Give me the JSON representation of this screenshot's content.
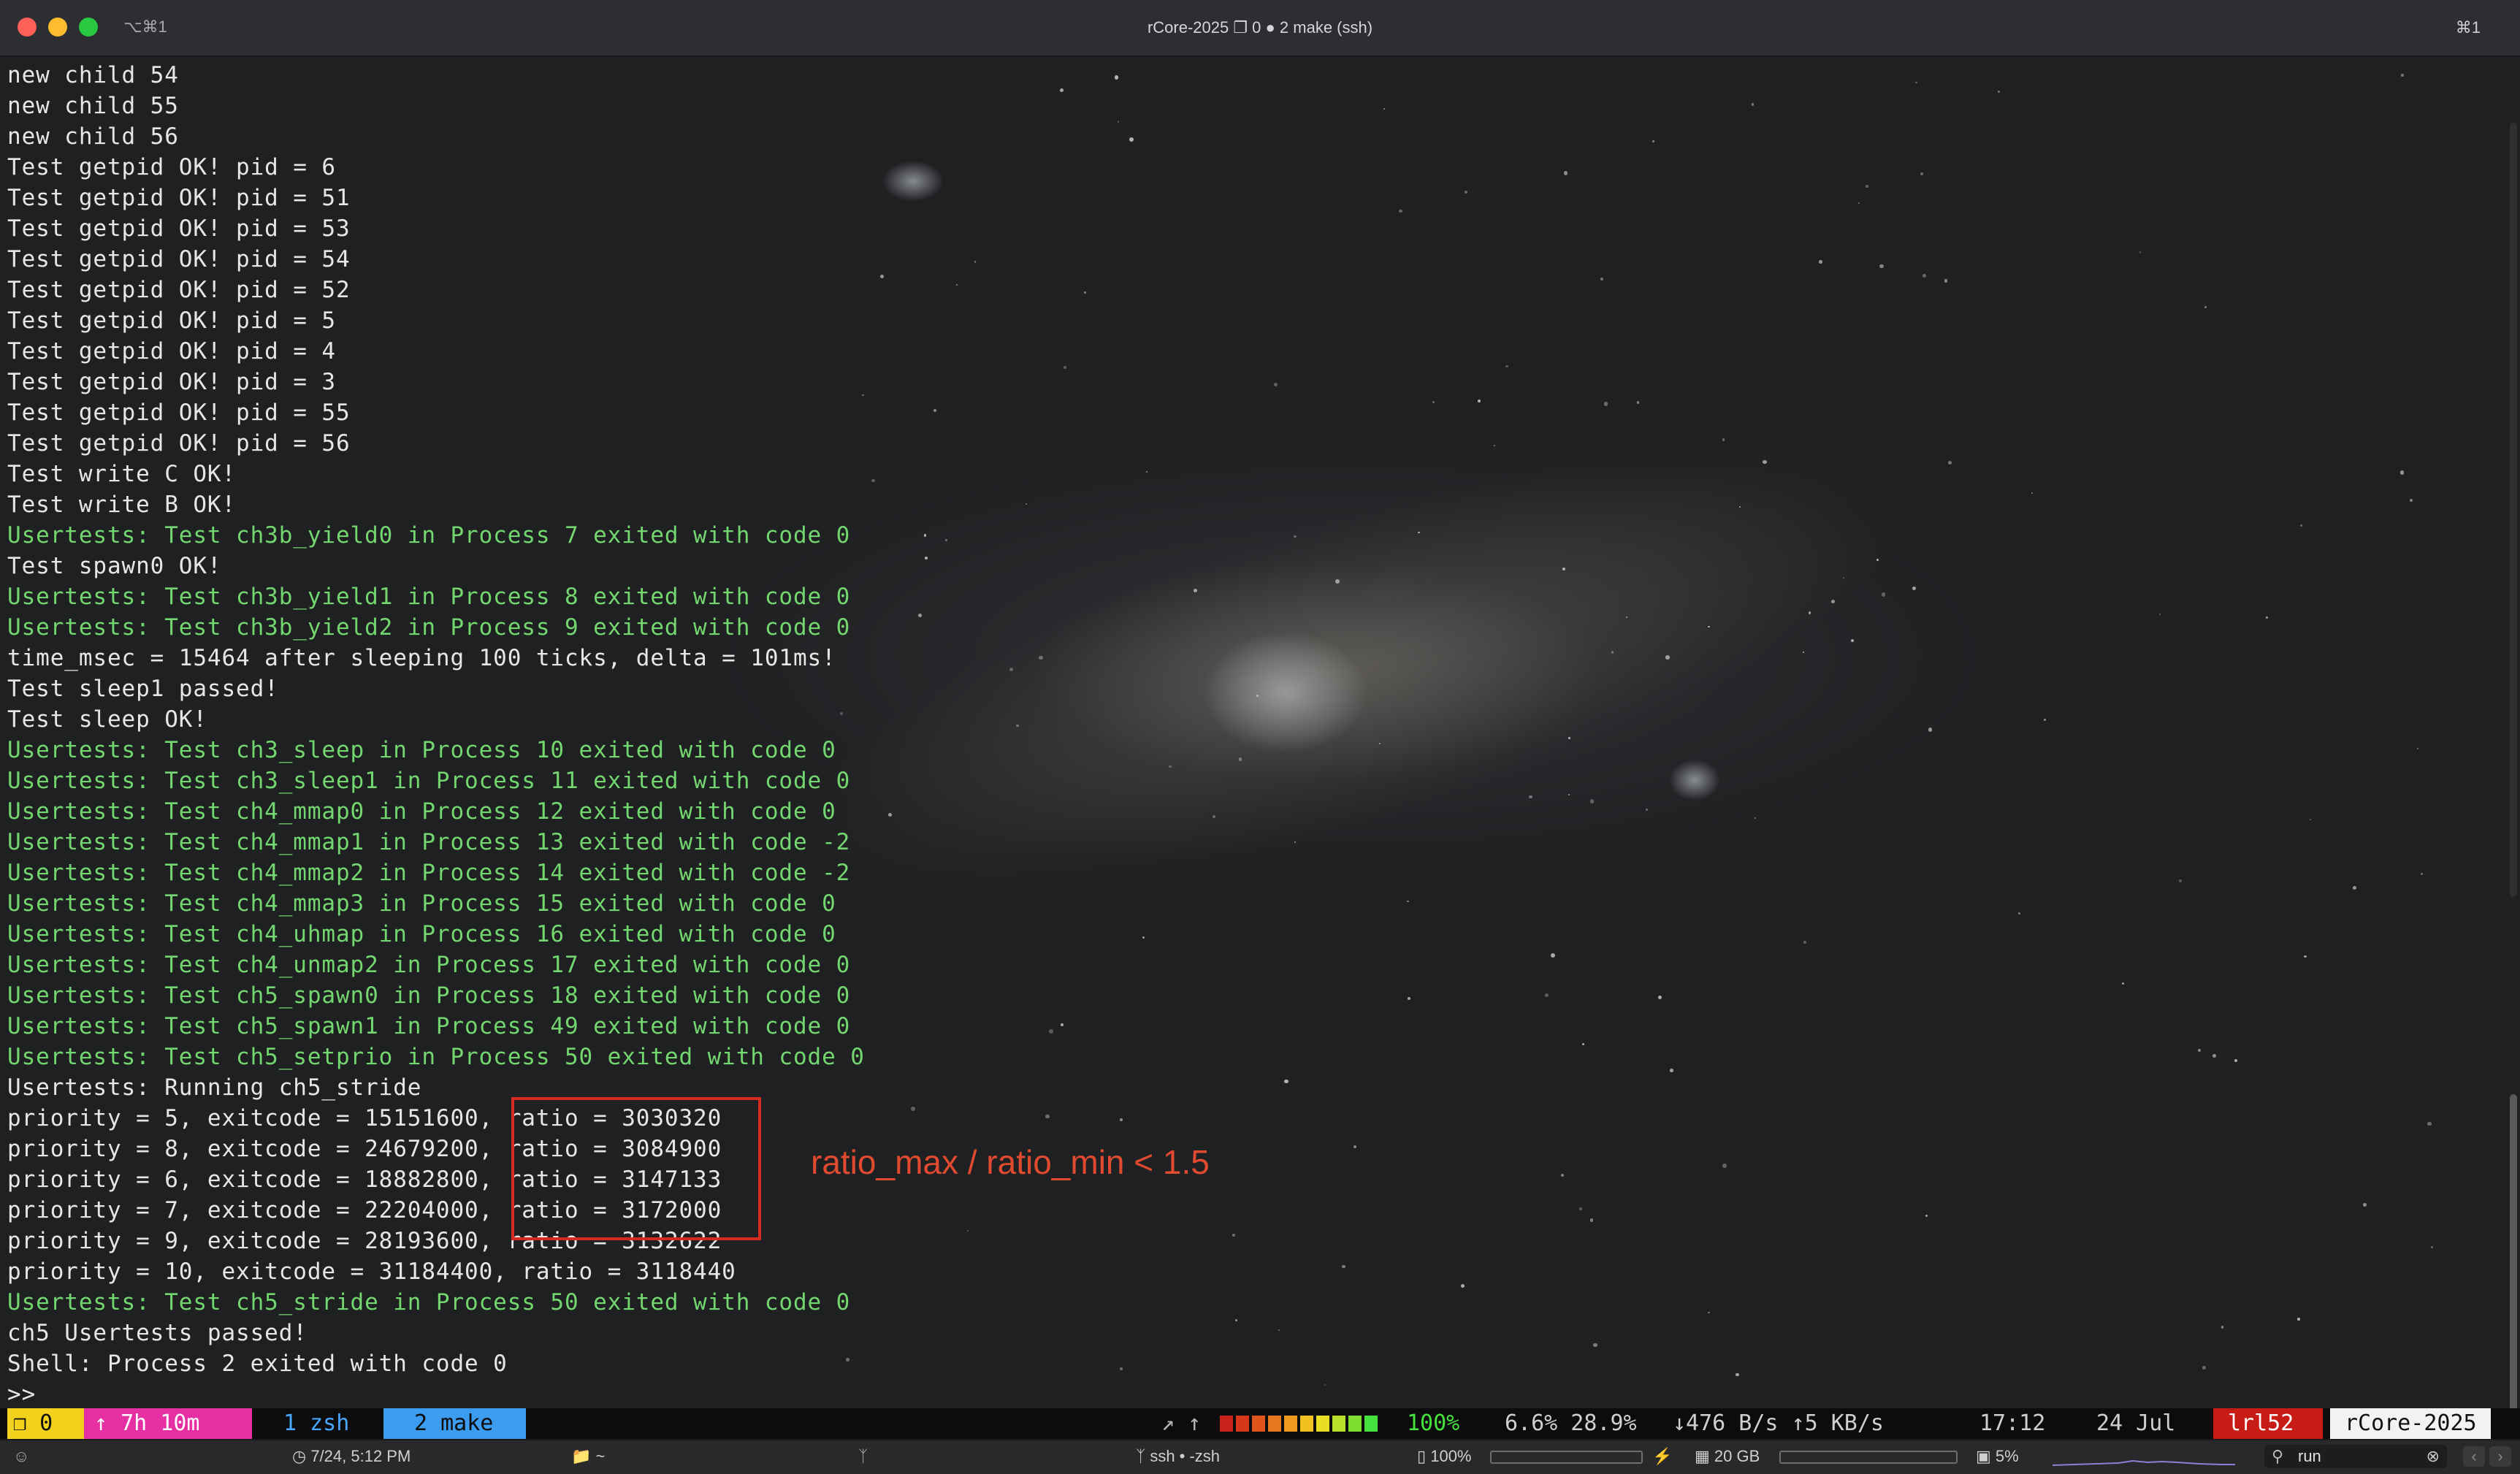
{
  "window": {
    "title": "rCore-2025 ❐ 0 ● 2 make (ssh)",
    "left_shortcut": "⌥⌘1",
    "right_shortcut": "⌘1"
  },
  "terminal": {
    "lines": [
      {
        "text": "new child 54",
        "style": "plain"
      },
      {
        "text": "new child 55",
        "style": "plain"
      },
      {
        "text": "new child 56",
        "style": "plain"
      },
      {
        "text": "Test getpid OK! pid = 6",
        "style": "plain"
      },
      {
        "text": "Test getpid OK! pid = 51",
        "style": "plain"
      },
      {
        "text": "Test getpid OK! pid = 53",
        "style": "plain"
      },
      {
        "text": "Test getpid OK! pid = 54",
        "style": "plain"
      },
      {
        "text": "Test getpid OK! pid = 52",
        "style": "plain"
      },
      {
        "text": "Test getpid OK! pid = 5",
        "style": "plain"
      },
      {
        "text": "Test getpid OK! pid = 4",
        "style": "plain"
      },
      {
        "text": "Test getpid OK! pid = 3",
        "style": "plain"
      },
      {
        "text": "Test getpid OK! pid = 55",
        "style": "plain"
      },
      {
        "text": "Test getpid OK! pid = 56",
        "style": "plain"
      },
      {
        "text": "Test write C OK!",
        "style": "plain"
      },
      {
        "text": "Test write B OK!",
        "style": "plain"
      },
      {
        "text": "Usertests: Test ch3b_yield0 in Process 7 exited with code 0",
        "style": "green"
      },
      {
        "text": "Test spawn0 OK!",
        "style": "plain"
      },
      {
        "text": "Usertests: Test ch3b_yield1 in Process 8 exited with code 0",
        "style": "green"
      },
      {
        "text": "Usertests: Test ch3b_yield2 in Process 9 exited with code 0",
        "style": "green"
      },
      {
        "text": "time_msec = 15464 after sleeping 100 ticks, delta = 101ms!",
        "style": "plain"
      },
      {
        "text": "Test sleep1 passed!",
        "style": "plain"
      },
      {
        "text": "Test sleep OK!",
        "style": "plain"
      },
      {
        "text": "Usertests: Test ch3_sleep in Process 10 exited with code 0",
        "style": "green"
      },
      {
        "text": "Usertests: Test ch3_sleep1 in Process 11 exited with code 0",
        "style": "green"
      },
      {
        "text": "Usertests: Test ch4_mmap0 in Process 12 exited with code 0",
        "style": "green"
      },
      {
        "text": "Usertests: Test ch4_mmap1 in Process 13 exited with code -2",
        "style": "green"
      },
      {
        "text": "Usertests: Test ch4_mmap2 in Process 14 exited with code -2",
        "style": "green"
      },
      {
        "text": "Usertests: Test ch4_mmap3 in Process 15 exited with code 0",
        "style": "green"
      },
      {
        "text": "Usertests: Test ch4_uhmap in Process 16 exited with code 0",
        "style": "green"
      },
      {
        "text": "Usertests: Test ch4_unmap2 in Process 17 exited with code 0",
        "style": "green"
      },
      {
        "text": "Usertests: Test ch5_spawn0 in Process 18 exited with code 0",
        "style": "green"
      },
      {
        "text": "Usertests: Test ch5_spawn1 in Process 49 exited with code 0",
        "style": "green"
      },
      {
        "text": "Usertests: Test ch5_setprio in Process 50 exited with code 0",
        "style": "green"
      },
      {
        "text": "Usertests: Running ch5_stride",
        "style": "plain"
      },
      {
        "text": "priority = 5, exitcode = 15151600, ratio = 3030320",
        "style": "plain"
      },
      {
        "text": "priority = 8, exitcode = 24679200, ratio = 3084900",
        "style": "plain"
      },
      {
        "text": "priority = 6, exitcode = 18882800, ratio = 3147133",
        "style": "plain"
      },
      {
        "text": "priority = 7, exitcode = 22204000, ratio = 3172000",
        "style": "plain"
      },
      {
        "text": "priority = 9, exitcode = 28193600, ratio = 3132622",
        "style": "plain"
      },
      {
        "text": "priority = 10, exitcode = 31184400, ratio = 3118440",
        "style": "plain"
      },
      {
        "text": "Usertests: Test ch5_stride in Process 50 exited with code 0",
        "style": "green"
      },
      {
        "text": "ch5 Usertests passed!",
        "style": "plain"
      },
      {
        "text": "Shell: Process 2 exited with code 0",
        "style": "plain"
      },
      {
        "text": ">>",
        "style": "prompt"
      }
    ],
    "annotation": "ratio_max / ratio_min < 1.5",
    "annotation_color": "#e04a2f",
    "box_color": "#d52a23"
  },
  "tmux": {
    "session": "❐ 0",
    "uptime": "↑ 7h 10m",
    "window1": "1 zsh",
    "window2": "2 make",
    "arrows": "↗ ↑",
    "battery": "100%",
    "load": "6.6% 28.9%",
    "net": "↓476 B/s ↑5 KB/s",
    "time": "17:12",
    "date": "24 Jul",
    "user": "lrl52",
    "host": "rCore-2025",
    "colors": {
      "session": "#f2d21c",
      "uptime": "#e52fa3",
      "window2": "#3b9cf0",
      "user": "#c71b15",
      "battery": "#46e23e"
    }
  },
  "statusbar": {
    "user_icon": "person-icon",
    "clock": "7/24, 5:12 PM",
    "folder": "~",
    "branch_icon": "git-branch-icon",
    "session": "ssh • -zsh",
    "battery": "100%",
    "battery_level": 1.0,
    "memory": "20 GB",
    "cpu": "5%",
    "search_value": "run"
  }
}
